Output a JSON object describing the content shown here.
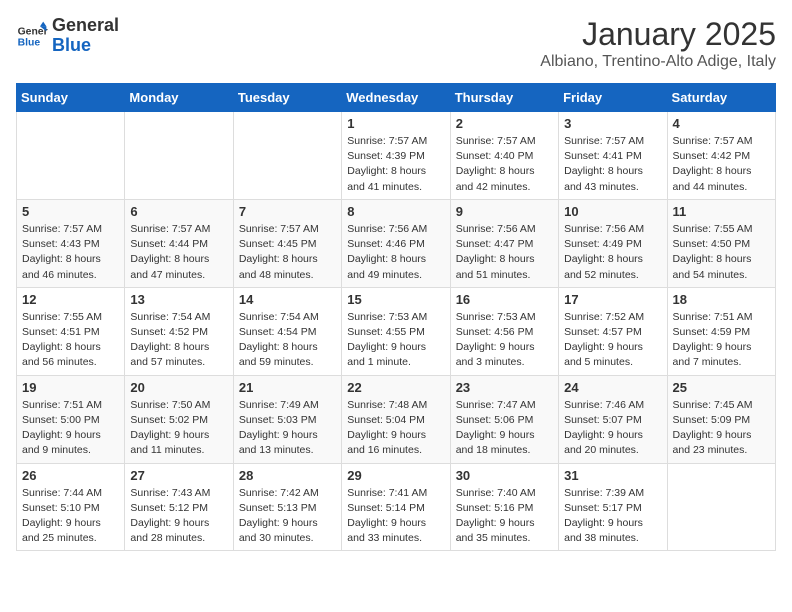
{
  "header": {
    "logo_general": "General",
    "logo_blue": "Blue",
    "title": "January 2025",
    "subtitle": "Albiano, Trentino-Alto Adige, Italy"
  },
  "weekdays": [
    "Sunday",
    "Monday",
    "Tuesday",
    "Wednesday",
    "Thursday",
    "Friday",
    "Saturday"
  ],
  "weeks": [
    [
      {
        "day": "",
        "info": ""
      },
      {
        "day": "",
        "info": ""
      },
      {
        "day": "",
        "info": ""
      },
      {
        "day": "1",
        "info": "Sunrise: 7:57 AM\nSunset: 4:39 PM\nDaylight: 8 hours\nand 41 minutes."
      },
      {
        "day": "2",
        "info": "Sunrise: 7:57 AM\nSunset: 4:40 PM\nDaylight: 8 hours\nand 42 minutes."
      },
      {
        "day": "3",
        "info": "Sunrise: 7:57 AM\nSunset: 4:41 PM\nDaylight: 8 hours\nand 43 minutes."
      },
      {
        "day": "4",
        "info": "Sunrise: 7:57 AM\nSunset: 4:42 PM\nDaylight: 8 hours\nand 44 minutes."
      }
    ],
    [
      {
        "day": "5",
        "info": "Sunrise: 7:57 AM\nSunset: 4:43 PM\nDaylight: 8 hours\nand 46 minutes."
      },
      {
        "day": "6",
        "info": "Sunrise: 7:57 AM\nSunset: 4:44 PM\nDaylight: 8 hours\nand 47 minutes."
      },
      {
        "day": "7",
        "info": "Sunrise: 7:57 AM\nSunset: 4:45 PM\nDaylight: 8 hours\nand 48 minutes."
      },
      {
        "day": "8",
        "info": "Sunrise: 7:56 AM\nSunset: 4:46 PM\nDaylight: 8 hours\nand 49 minutes."
      },
      {
        "day": "9",
        "info": "Sunrise: 7:56 AM\nSunset: 4:47 PM\nDaylight: 8 hours\nand 51 minutes."
      },
      {
        "day": "10",
        "info": "Sunrise: 7:56 AM\nSunset: 4:49 PM\nDaylight: 8 hours\nand 52 minutes."
      },
      {
        "day": "11",
        "info": "Sunrise: 7:55 AM\nSunset: 4:50 PM\nDaylight: 8 hours\nand 54 minutes."
      }
    ],
    [
      {
        "day": "12",
        "info": "Sunrise: 7:55 AM\nSunset: 4:51 PM\nDaylight: 8 hours\nand 56 minutes."
      },
      {
        "day": "13",
        "info": "Sunrise: 7:54 AM\nSunset: 4:52 PM\nDaylight: 8 hours\nand 57 minutes."
      },
      {
        "day": "14",
        "info": "Sunrise: 7:54 AM\nSunset: 4:54 PM\nDaylight: 8 hours\nand 59 minutes."
      },
      {
        "day": "15",
        "info": "Sunrise: 7:53 AM\nSunset: 4:55 PM\nDaylight: 9 hours\nand 1 minute."
      },
      {
        "day": "16",
        "info": "Sunrise: 7:53 AM\nSunset: 4:56 PM\nDaylight: 9 hours\nand 3 minutes."
      },
      {
        "day": "17",
        "info": "Sunrise: 7:52 AM\nSunset: 4:57 PM\nDaylight: 9 hours\nand 5 minutes."
      },
      {
        "day": "18",
        "info": "Sunrise: 7:51 AM\nSunset: 4:59 PM\nDaylight: 9 hours\nand 7 minutes."
      }
    ],
    [
      {
        "day": "19",
        "info": "Sunrise: 7:51 AM\nSunset: 5:00 PM\nDaylight: 9 hours\nand 9 minutes."
      },
      {
        "day": "20",
        "info": "Sunrise: 7:50 AM\nSunset: 5:02 PM\nDaylight: 9 hours\nand 11 minutes."
      },
      {
        "day": "21",
        "info": "Sunrise: 7:49 AM\nSunset: 5:03 PM\nDaylight: 9 hours\nand 13 minutes."
      },
      {
        "day": "22",
        "info": "Sunrise: 7:48 AM\nSunset: 5:04 PM\nDaylight: 9 hours\nand 16 minutes."
      },
      {
        "day": "23",
        "info": "Sunrise: 7:47 AM\nSunset: 5:06 PM\nDaylight: 9 hours\nand 18 minutes."
      },
      {
        "day": "24",
        "info": "Sunrise: 7:46 AM\nSunset: 5:07 PM\nDaylight: 9 hours\nand 20 minutes."
      },
      {
        "day": "25",
        "info": "Sunrise: 7:45 AM\nSunset: 5:09 PM\nDaylight: 9 hours\nand 23 minutes."
      }
    ],
    [
      {
        "day": "26",
        "info": "Sunrise: 7:44 AM\nSunset: 5:10 PM\nDaylight: 9 hours\nand 25 minutes."
      },
      {
        "day": "27",
        "info": "Sunrise: 7:43 AM\nSunset: 5:12 PM\nDaylight: 9 hours\nand 28 minutes."
      },
      {
        "day": "28",
        "info": "Sunrise: 7:42 AM\nSunset: 5:13 PM\nDaylight: 9 hours\nand 30 minutes."
      },
      {
        "day": "29",
        "info": "Sunrise: 7:41 AM\nSunset: 5:14 PM\nDaylight: 9 hours\nand 33 minutes."
      },
      {
        "day": "30",
        "info": "Sunrise: 7:40 AM\nSunset: 5:16 PM\nDaylight: 9 hours\nand 35 minutes."
      },
      {
        "day": "31",
        "info": "Sunrise: 7:39 AM\nSunset: 5:17 PM\nDaylight: 9 hours\nand 38 minutes."
      },
      {
        "day": "",
        "info": ""
      }
    ]
  ]
}
